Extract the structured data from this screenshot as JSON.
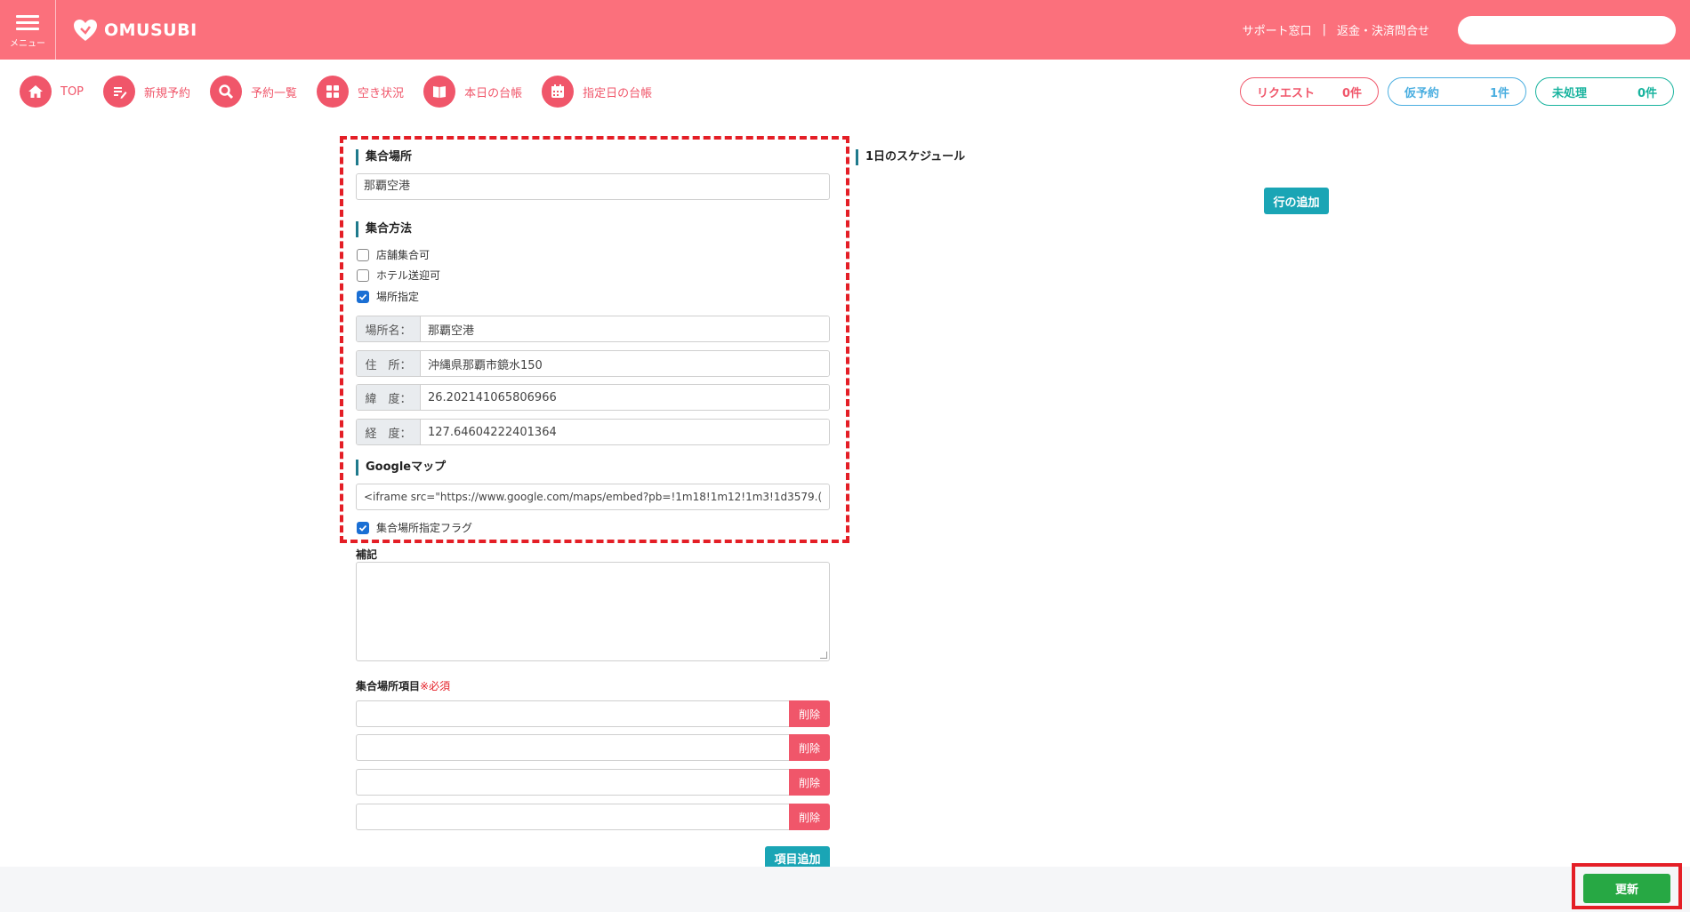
{
  "header": {
    "menu_label": "メニュー",
    "logo_text": "OMUSUBI",
    "support_link": "サポート窓口",
    "separator": "|",
    "refund_link": "返金・決済問合せ",
    "search_placeholder": ""
  },
  "nav": {
    "items": [
      {
        "label": "TOP",
        "icon": "home-icon"
      },
      {
        "label": "新規予約",
        "icon": "edit-icon"
      },
      {
        "label": "予約一覧",
        "icon": "search-icon"
      },
      {
        "label": "空き状況",
        "icon": "grid-icon"
      },
      {
        "label": "本日の台帳",
        "icon": "book-icon"
      },
      {
        "label": "指定日の台帳",
        "icon": "calendar-icon"
      }
    ],
    "status": {
      "request": {
        "label": "リクエスト",
        "count": "0件"
      },
      "tentative": {
        "label": "仮予約",
        "count": "1件"
      },
      "unprocessed": {
        "label": "未処理",
        "count": "0件"
      }
    }
  },
  "form": {
    "meeting_place": {
      "title": "集合場所",
      "value": "那覇空港"
    },
    "meeting_method": {
      "title": "集合方法",
      "options": [
        {
          "label": "店舗集合可",
          "checked": false
        },
        {
          "label": "ホテル送迎可",
          "checked": false
        },
        {
          "label": "場所指定",
          "checked": true
        }
      ]
    },
    "location": {
      "name_label": "場所名：",
      "name_value": "那覇空港",
      "address_label": "住　所：",
      "address_value": "沖縄県那覇市鏡水150",
      "lat_label": "緯　度：",
      "lat_value": "26.202141065806966",
      "lng_label": "経　度：",
      "lng_value": "127.64604222401364"
    },
    "google_map": {
      "title": "Googleマップ",
      "value": "<iframe src=\"https://www.google.com/maps/embed?pb=!1m18!1m12!1m3!1d3579.("
    },
    "meeting_flag": {
      "label": "集合場所指定フラグ",
      "checked": true
    },
    "notes": {
      "title": "補記"
    },
    "items": {
      "title": "集合場所項目",
      "required": "※必須",
      "delete_label": "削除",
      "add_label": "項目追加",
      "rows": [
        "",
        "",
        "",
        ""
      ]
    }
  },
  "schedule": {
    "title": "1日のスケジュール",
    "add_row_label": "行の追加"
  },
  "footer": {
    "update_label": "更新"
  }
}
